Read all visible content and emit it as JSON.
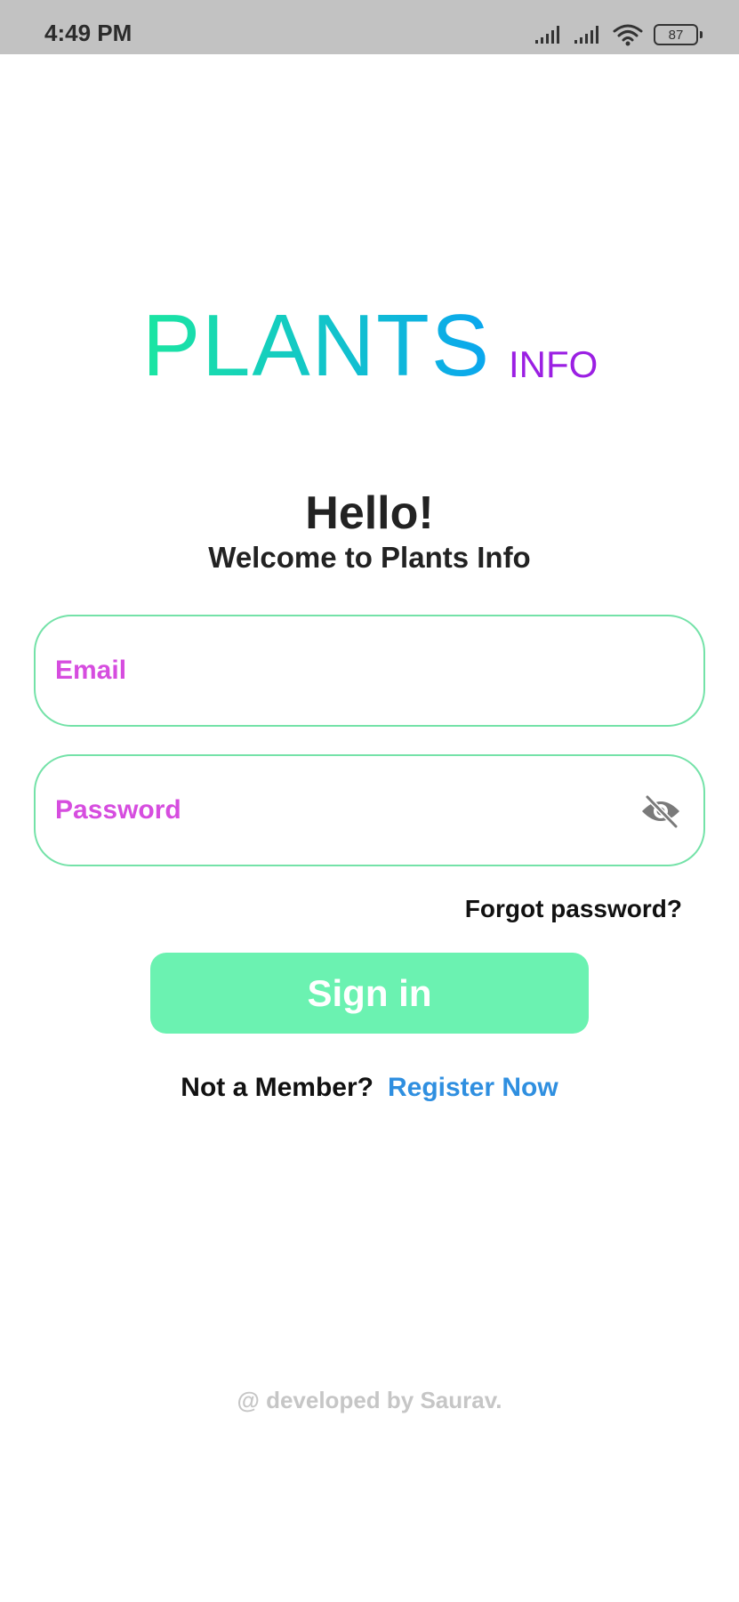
{
  "status_bar": {
    "time": "4:49 PM",
    "battery": "87",
    "icons": [
      "cellular-signal-icon",
      "cellular-signal-icon",
      "wifi-icon",
      "battery-icon"
    ]
  },
  "logo": {
    "main": "PLANTS",
    "sub": "INFO",
    "colors": {
      "gradient_start": "#1be6a1",
      "gradient_end": "#0aa6ef",
      "sub": "#9b1fe3"
    }
  },
  "greeting": {
    "title": "Hello!",
    "subtitle": "Welcome to Plants Info"
  },
  "form": {
    "email_placeholder": "Email",
    "email_value": "",
    "password_placeholder": "Password",
    "password_value": "",
    "password_toggle_icon": "eye-off-icon",
    "forgot_label": "Forgot password?",
    "signin_label": "Sign in"
  },
  "register": {
    "prompt": "Not a Member?",
    "link_label": "Register Now"
  },
  "footer": {
    "credit": "@ developed by Saurav."
  },
  "colors": {
    "accent_border": "#74e2a8",
    "button_bg": "#6bf2b1",
    "placeholder": "#d64ddf",
    "link": "#2f8fe0"
  }
}
